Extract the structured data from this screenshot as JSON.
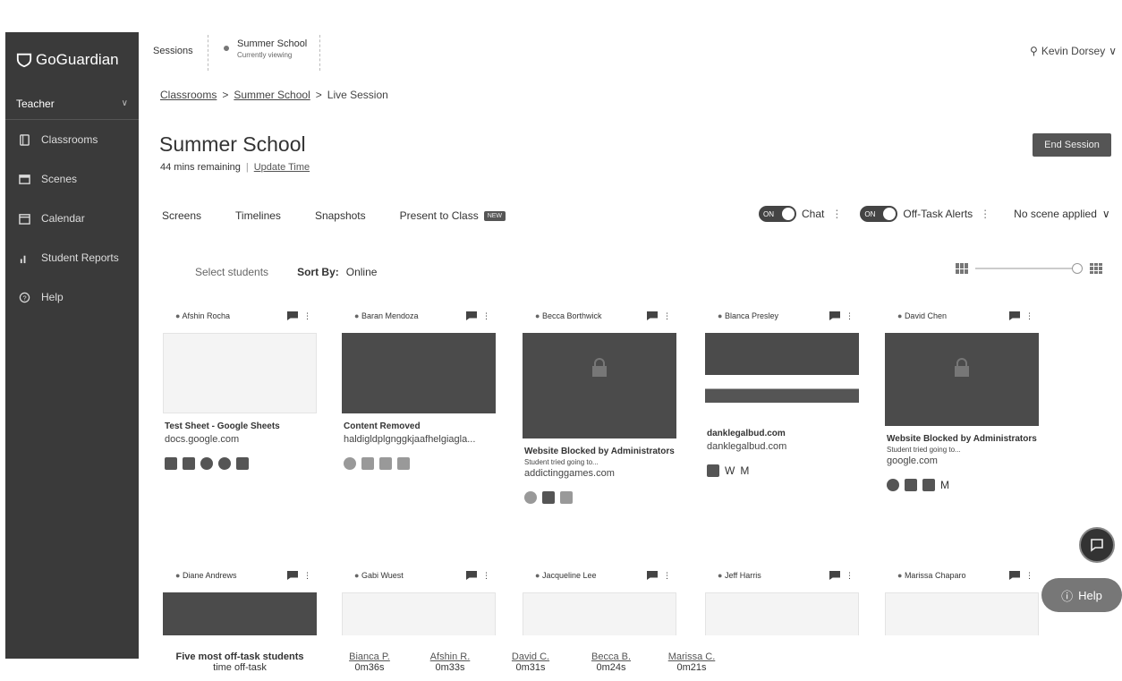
{
  "sidebar": {
    "brand": "GoGuardian",
    "role": "Teacher",
    "items": [
      {
        "label": "Classrooms",
        "icon": "classroom-icon"
      },
      {
        "label": "Scenes",
        "icon": "scenes-icon"
      },
      {
        "label": "Calendar",
        "icon": "calendar-icon"
      },
      {
        "label": "Student Reports",
        "icon": "reports-icon"
      },
      {
        "label": "Help",
        "icon": "help-icon"
      }
    ]
  },
  "topbar": {
    "sessions_label": "Sessions",
    "session_name": "Summer School",
    "session_status": "Currently viewing",
    "user": "Kevin Dorsey"
  },
  "breadcrumb": [
    "Classrooms",
    "Summer School",
    "Live Session"
  ],
  "page": {
    "title": "Summer School",
    "remaining": "44 mins remaining",
    "update_time": "Update Time",
    "end_session": "End Session"
  },
  "tabs": [
    {
      "label": "Screens"
    },
    {
      "label": "Timelines"
    },
    {
      "label": "Snapshots"
    },
    {
      "label": "Present to Class",
      "badge": "NEW"
    }
  ],
  "toggles": {
    "chat_state": "ON",
    "chat_label": "Chat",
    "alerts_state": "ON",
    "alerts_label": "Off-Task Alerts",
    "scene": "No scene applied"
  },
  "filters": {
    "select_students": "Select students",
    "sort_label": "Sort By:",
    "sort_value": "Online"
  },
  "cards": [
    {
      "name": "Afshin Rocha",
      "title": "Test Sheet - Google Sheets",
      "sub": "",
      "url": "docs.google.com"
    },
    {
      "name": "Baran Mendoza",
      "title": "Content Removed",
      "sub": "",
      "url": "haldigldplgnggkjaafhelgiagla..."
    },
    {
      "name": "Becca Borthwick",
      "title": "Website Blocked by Administrators",
      "sub": "Student tried going to...",
      "url": "addictinggames.com"
    },
    {
      "name": "Blanca Presley",
      "title": "",
      "sub": "",
      "url": "danklegalbud.com",
      "title2": "danklegalbud.com"
    },
    {
      "name": "David Chen",
      "title": "Website Blocked by Administrators",
      "sub": "Student tried going to...",
      "url": "google.com"
    },
    {
      "name": "Diane Andrews"
    },
    {
      "name": "Gabi Wuest"
    },
    {
      "name": "Jacqueline Lee"
    },
    {
      "name": "Jeff Harris"
    },
    {
      "name": "Marissa Chaparo"
    }
  ],
  "help_label": "Help",
  "offtask": {
    "title": "Five most off-task students",
    "subtitle": "time off-task",
    "students": [
      {
        "name": "Bianca P.",
        "time": "0m36s"
      },
      {
        "name": "Afshin R.",
        "time": "0m33s"
      },
      {
        "name": "David C.",
        "time": "0m31s"
      },
      {
        "name": "Becca B.",
        "time": "0m24s"
      },
      {
        "name": "Marissa C.",
        "time": "0m21s"
      }
    ]
  }
}
